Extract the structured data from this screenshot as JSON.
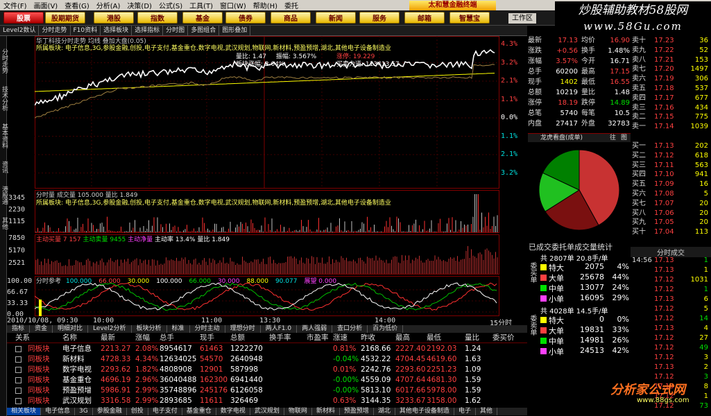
{
  "menu": [
    "文件(F)",
    "画面(V)",
    "查看(G)",
    "分析(A)",
    "决策(D)",
    "公式(S)",
    "工具(T)",
    "窗口(W)",
    "帮助(H)",
    "委托"
  ],
  "banner": "太和慧金融终端",
  "nav": [
    {
      "label": "股票",
      "active": true
    },
    {
      "label": "股期期货",
      "active": false
    },
    {
      "label": "港股",
      "active": false
    },
    {
      "label": "指数",
      "active": false
    },
    {
      "label": "基金",
      "active": false
    },
    {
      "label": "债券",
      "active": false
    },
    {
      "label": "商品",
      "active": false
    },
    {
      "label": "新闻",
      "active": false
    },
    {
      "label": "服务",
      "active": false
    },
    {
      "label": "邮箱",
      "active": false
    },
    {
      "label": "智慧宝",
      "active": false
    }
  ],
  "workspace": "工作区",
  "watermark": {
    "line1": "炒股辅助教材58股网",
    "line2": "www.58Gu.com"
  },
  "toolbar2": [
    "Level2数认",
    "分时走势",
    "F10资料",
    "选择板块",
    "选择指标",
    "分时图",
    "多图组合",
    "图形叠加"
  ],
  "lefttabs": [
    "分时走势",
    "技术分析",
    "基本资料",
    "资讯",
    "港股通",
    "其他"
  ],
  "chart_title": "华丁科技分时走势 均线 叠加大盘(0.05)",
  "price_axis_right": [
    "4.3%",
    "3.2%",
    "2.1%",
    "1.1%",
    "0.0%",
    "1.1%",
    "2.1%",
    "3.2%"
  ],
  "price_info": {
    "l1": "所属板块: 电子信息,3G,参股金融,创投,电子支付,基金重仓,数字电视,武汉规划,物联网,新材料,预盈预增,湖北,其他电子设备制造业",
    "liangbi": "量比: 1.47",
    "zhenfu": "振幅: 3.567%",
    "weibi": "板块涨幅: 2.04%",
    "zhangting": "涨停: 19.229",
    "big": "买卖力道: 113413.57"
  },
  "vol_title": "分时量 成交量 105.000 量比 1.849",
  "vol_axis": [
    "3345",
    "2230",
    "1115"
  ],
  "vol_sector": "所属板块: 电子信息,3G,参股金融,创投,电子支付,基金重仓,数字电视,武汉规划,物联网,新材料,预盈预增,湖北,其他电子设备制造业",
  "ind2_title": {
    "a": "主动买量 7 157",
    "b": "主动卖量 9455",
    "c": "主动净量",
    "d": "主动率 13.4%",
    "e": "量比 1.849"
  },
  "ind2_axis": [
    "7850",
    "5170",
    "2521"
  ],
  "ind3_title": "分时参考",
  "ind3_axis": [
    "100.00",
    "66.67",
    "33.33",
    "0.00"
  ],
  "ind3_legend": [
    "100.000",
    "66.000",
    "30.000",
    "100.000",
    "66.000",
    "30.000",
    "88.000",
    "90.077",
    "展望 0.000"
  ],
  "time_axis": {
    "date": "2010/10/08, 09:30",
    "t1": "10:00",
    "t2": "11:00",
    "t3": "13:30",
    "t4": "14:00",
    "t5": "15分时"
  },
  "subtabs": [
    "指标",
    "资金",
    "明细对比",
    "Level2分析",
    "板块分析",
    "标准",
    "分时主动",
    "理想分时",
    "两人F1.0",
    "两人强弱",
    "查口分析",
    "百为低价"
  ],
  "table_headers": [
    "关系",
    "",
    "名称",
    "最新",
    "涨幅",
    "总手",
    "现手",
    "总额",
    "换手率",
    "市盈率",
    "涨速",
    "昨收",
    "最高",
    "最低",
    "量比",
    "委买价"
  ],
  "table_rows": [
    {
      "rel": "同板块",
      "name": "电子信息",
      "last": "2213.27",
      "chg": "2.08%",
      "vol": "8954617",
      "cur": "61463",
      "amt": "1222270",
      "rate": "0.81%",
      "close": "2168.66",
      "high": "2227.40",
      "low": "2192.03",
      "lb": "1.24"
    },
    {
      "rel": "同板块",
      "name": "新材料",
      "last": "4728.33",
      "chg": "4.34%",
      "vol": "12634025",
      "cur": "54570",
      "amt": "2640948",
      "rate": "-0.04%",
      "close": "4532.22",
      "high": "4704.45",
      "low": "4619.60",
      "lb": "1.63"
    },
    {
      "rel": "同板块",
      "name": "数字电视",
      "last": "2293.62",
      "chg": "1.82%",
      "vol": "4808908",
      "cur": "12901",
      "amt": "587998",
      "rate": "0.01%",
      "close": "2242.76",
      "high": "2293.60",
      "low": "2251.23",
      "lb": "1.09"
    },
    {
      "rel": "同板块",
      "name": "基金重仓",
      "last": "4696.19",
      "chg": "2.96%",
      "vol": "36040488",
      "cur": "162300",
      "amt": "6941440",
      "rate": "-0.00%",
      "close": "4559.09",
      "high": "4707.64",
      "low": "4681.30",
      "lb": "1.59"
    },
    {
      "rel": "同板块",
      "name": "预盈预增",
      "last": "5986.91",
      "chg": "2.99%",
      "vol": "35748896",
      "cur": "245176",
      "amt": "6126058",
      "rate": "-0.00%",
      "close": "5813.10",
      "high": "6017.66",
      "low": "5978.00",
      "lb": "1.59"
    },
    {
      "rel": "同板块",
      "name": "武汉规划",
      "last": "3316.58",
      "chg": "2.99%",
      "vol": "2893685",
      "cur": "11611",
      "amt": "326469",
      "rate": "0.63%",
      "close": "3144.35",
      "high": "3233.67",
      "low": "3158.00",
      "lb": "1.62"
    }
  ],
  "bottomtabs": [
    "相关板块",
    "电子信息",
    "3G",
    "参股金融",
    "创投",
    "电子支付",
    "基金重仓",
    "数字电视",
    "武汉规划",
    "物联网",
    "新材料",
    "预盈预增",
    "湖北",
    "其他电子设备制造",
    "电子",
    "其他"
  ],
  "quote": [
    {
      "l": "最新",
      "lv": "17.13",
      "r": "均价",
      "rv": "16.90"
    },
    {
      "l": "涨跌",
      "lv": "+0.56",
      "r": "换手",
      "rv": "1.48%"
    },
    {
      "l": "涨幅",
      "lv": "3.57%",
      "r": "今开",
      "rv": "16.71"
    },
    {
      "l": "总手",
      "lv": "60200",
      "r": "最高",
      "rv": "17.15"
    },
    {
      "l": "现手",
      "lv": "1402",
      "r": "最低",
      "rv": "16.55"
    },
    {
      "l": "总额",
      "lv": "10219",
      "r": "量比",
      "rv": "1.48"
    },
    {
      "l": "涨停",
      "lv": "18.19",
      "r": "跌停",
      "rv": "14.89"
    },
    {
      "l": "总笔",
      "lv": "5740",
      "r": "每笔",
      "rv": "10.5"
    },
    {
      "l": "内盘",
      "lv": "27417",
      "r": "外盘",
      "rv": "32783"
    }
  ],
  "sell_book": [
    {
      "n": "卖十",
      "p": "17.23",
      "v": "36"
    },
    {
      "n": "卖九",
      "p": "17.22",
      "v": "52"
    },
    {
      "n": "卖八",
      "p": "17.21",
      "v": "153"
    },
    {
      "n": "卖七",
      "p": "17.20",
      "v": "1497"
    },
    {
      "n": "卖六",
      "p": "17.19",
      "v": "306"
    },
    {
      "n": "卖五",
      "p": "17.18",
      "v": "537"
    },
    {
      "n": "卖四",
      "p": "17.17",
      "v": "677"
    },
    {
      "n": "卖三",
      "p": "17.16",
      "v": "434"
    },
    {
      "n": "卖二",
      "p": "17.15",
      "v": "775"
    },
    {
      "n": "卖一",
      "p": "17.14",
      "v": "1039"
    }
  ],
  "buy_book": [
    {
      "n": "买一",
      "p": "17.13",
      "v": "202"
    },
    {
      "n": "买二",
      "p": "17.12",
      "v": "618"
    },
    {
      "n": "买三",
      "p": "17.11",
      "v": "563"
    },
    {
      "n": "买四",
      "p": "17.10",
      "v": "941"
    },
    {
      "n": "买五",
      "p": "17.09",
      "v": "16"
    },
    {
      "n": "买六",
      "p": "17.08",
      "v": "5"
    },
    {
      "n": "买七",
      "p": "17.07",
      "v": "20"
    },
    {
      "n": "买八",
      "p": "17.06",
      "v": "20"
    },
    {
      "n": "买九",
      "p": "17.05",
      "v": "20"
    },
    {
      "n": "买十",
      "p": "17.04",
      "v": "113"
    }
  ],
  "dragon_title": "龙虎看盘(成单)",
  "dragon_tabs": [
    "往",
    "图"
  ],
  "pie": [
    {
      "v": 0.42,
      "c": "#c83232"
    },
    {
      "v": 0.24,
      "c": "#7a1010"
    },
    {
      "v": 0.16,
      "c": "#20c020"
    },
    {
      "v": 0.18,
      "c": "#008000"
    }
  ],
  "stats_title": "已成交委托单成交量统计",
  "stats1": {
    "head": "共 2807单 20.8手/单",
    "side": "委买单",
    "rows": [
      {
        "k": "特大",
        "v": "2075",
        "p": "4%"
      },
      {
        "k": "大单",
        "v": "25678",
        "p": "44%"
      },
      {
        "k": "中单",
        "v": "13077",
        "p": "24%"
      },
      {
        "k": "小单",
        "v": "16095",
        "p": "29%"
      }
    ]
  },
  "stats2": {
    "head": "共 4028单 14.5手/单",
    "side": "委卖单",
    "rows": [
      {
        "k": "特大",
        "v": "0",
        "p": "0%"
      },
      {
        "k": "大单",
        "v": "19831",
        "p": "33%"
      },
      {
        "k": "中单",
        "v": "14981",
        "p": "26%"
      },
      {
        "k": "小单",
        "v": "24513",
        "p": "42%"
      }
    ]
  },
  "ticks_title": "分时成交",
  "ticks": [
    [
      "14:56",
      "17.13",
      "1"
    ],
    [
      "",
      "17.13",
      "1"
    ],
    [
      "",
      "17.12",
      "1031"
    ],
    [
      "",
      "17.12",
      "1"
    ],
    [
      "",
      "17.13",
      "6"
    ],
    [
      "",
      "17.12",
      "5"
    ],
    [
      "",
      "17.12",
      "14"
    ],
    [
      "",
      "17.13",
      "4"
    ],
    [
      "",
      "17.12",
      "27"
    ],
    [
      "",
      "17.12",
      "49"
    ],
    [
      "",
      "17.12",
      "3"
    ],
    [
      "",
      "17.13",
      "2"
    ],
    [
      "",
      "17.12",
      "3"
    ],
    [
      "",
      "17.13",
      "8"
    ],
    [
      "",
      "17.12",
      "1"
    ],
    [
      "",
      "17.12",
      "73"
    ]
  ],
  "footer_logo": "分析家公式网",
  "footer_url": "www.88gs.com"
}
